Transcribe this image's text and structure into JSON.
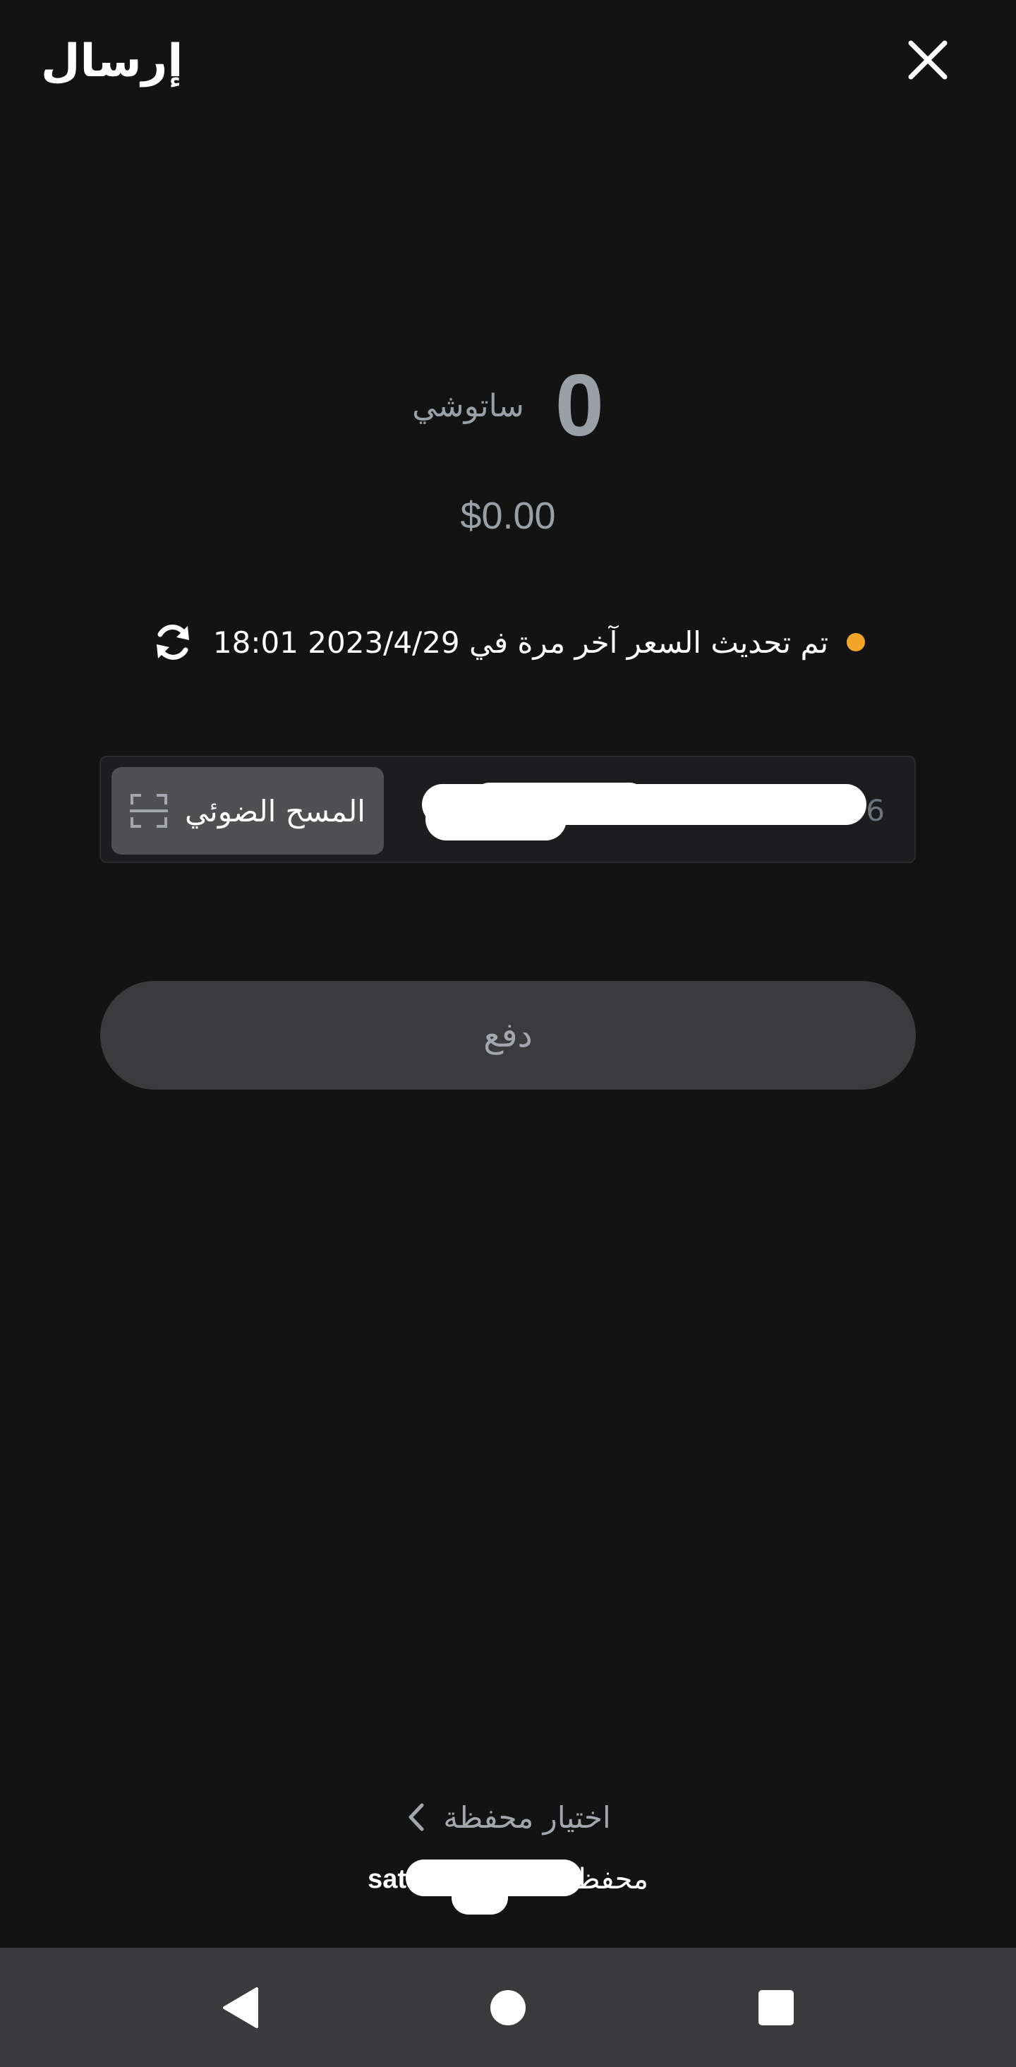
{
  "header": {
    "title": "إرسال"
  },
  "amount": {
    "value": "0",
    "unit": "ساتوشي",
    "fiat": "$0.00"
  },
  "rate": {
    "text": "تم تحديث السعر آخر مرة في 2023/4/29 18:01"
  },
  "address_input": {
    "visible_prefix": "6",
    "scan_label": "المسح الضوئي"
  },
  "pay_button": {
    "label": "دفع"
  },
  "wallet": {
    "select_label": "اختيار محفظة",
    "name": "محفظة",
    "unit": "sats"
  },
  "colors": {
    "background": "#131313",
    "status_dot": "#f2a529",
    "muted_text": "#9aa0a8",
    "nav_bar": "#3a3a3c"
  }
}
